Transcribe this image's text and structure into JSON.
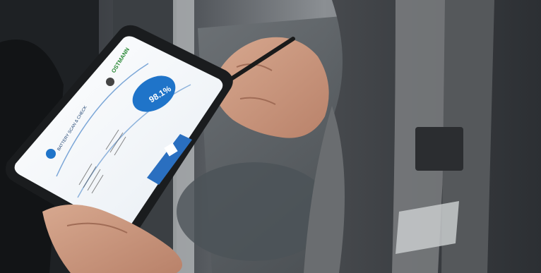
{
  "tablet_screen": {
    "brand_left": "BATTERY\nSCAN & CHECK",
    "brand_right": "OSTMANN",
    "gauge_value": "98.1%",
    "colors": {
      "screen_bg": "#ffffff",
      "gauge_blue": "#1f74c9",
      "button_blue": "#2a6fc0",
      "brand_green": "#2e8b3a",
      "tablet_body": "#1a1c1e"
    }
  }
}
